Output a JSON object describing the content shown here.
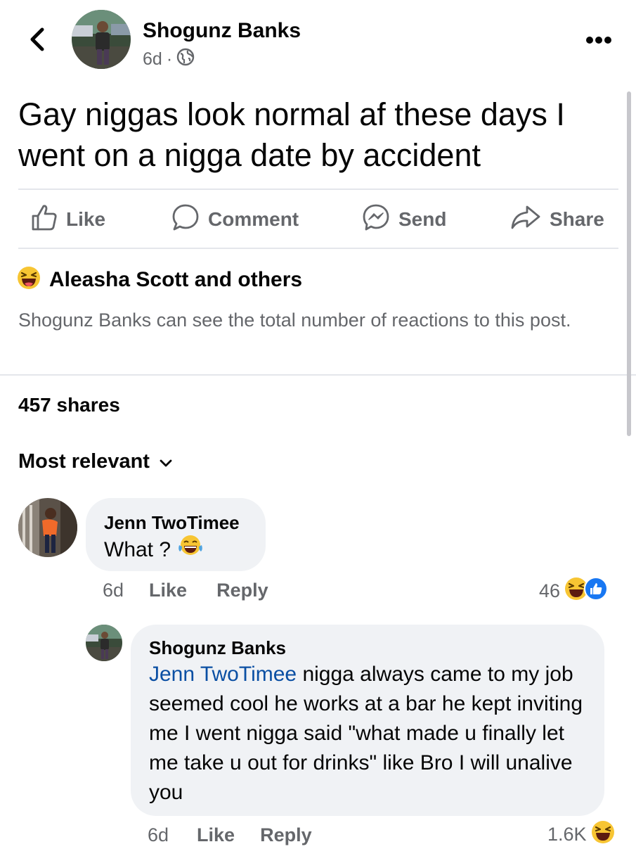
{
  "post": {
    "author": "Shogunz Banks",
    "time": "6d",
    "separator": "·",
    "privacy_icon": "globe-icon",
    "text": "Gay niggas look normal af these days I went on a nigga date by accident"
  },
  "actions": {
    "like": "Like",
    "comment": "Comment",
    "send": "Send",
    "share": "Share"
  },
  "reactions": {
    "icon": "laughing-emoji-icon",
    "label": "Aleasha Scott and others",
    "notice": "Shogunz Banks can see the total number of reactions to this post."
  },
  "shares": "457 shares",
  "sort": {
    "label": "Most relevant"
  },
  "comments": [
    {
      "author": "Jenn TwoTimee",
      "text": "What ?",
      "time": "6d",
      "like": "Like",
      "reply": "Reply",
      "reaction_count": "46"
    }
  ],
  "reply": {
    "author": "Shogunz Banks",
    "mention": "Jenn TwoTimee",
    "text": " nigga always came to my job seemed cool he works at a bar he kept inviting me I went nigga said \"what made u finally let me take u out for drinks\" like Bro I will unalive you",
    "time": "6d",
    "like": "Like",
    "reply": "Reply",
    "reaction_count": "1.6K"
  },
  "colors": {
    "accent": "#1877f2",
    "muted": "#65676b",
    "bubble": "#f0f2f5",
    "mention": "#0a4fa3"
  }
}
